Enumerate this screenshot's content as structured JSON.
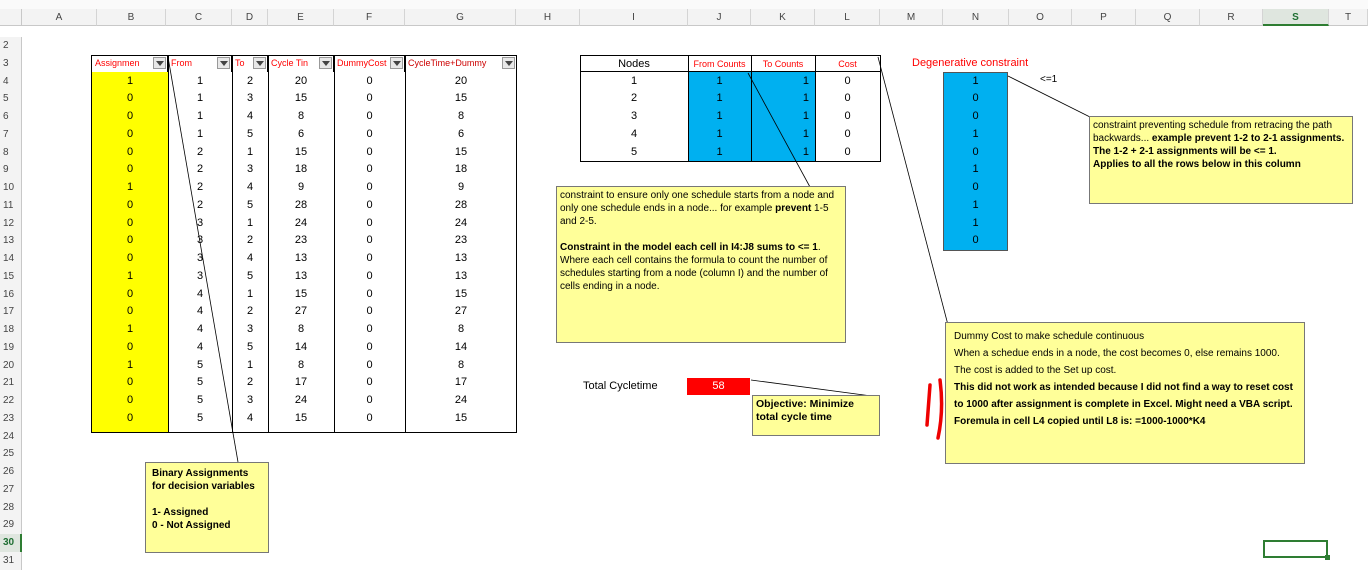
{
  "columns": [
    "A",
    "B",
    "C",
    "D",
    "E",
    "F",
    "G",
    "H",
    "I",
    "J",
    "K",
    "L",
    "M",
    "N",
    "O",
    "P",
    "Q",
    "R",
    "S",
    "T"
  ],
  "rows": [
    "2",
    "3",
    "4",
    "5",
    "6",
    "7",
    "8",
    "9",
    "10",
    "11",
    "12",
    "13",
    "14",
    "15",
    "16",
    "17",
    "18",
    "19",
    "20",
    "21",
    "22",
    "23",
    "24",
    "25",
    "26",
    "27",
    "28",
    "29",
    "30",
    "31"
  ],
  "selected_column": "S",
  "selected_row": "30",
  "assignment_table": {
    "headers": [
      "Assignmen",
      "From",
      "To",
      "Cycle Tin",
      "DummyCost",
      "CycleTime+Dummy"
    ],
    "rows": [
      [
        "1",
        "1",
        "2",
        "20",
        "0",
        "20"
      ],
      [
        "0",
        "1",
        "3",
        "15",
        "0",
        "15"
      ],
      [
        "0",
        "1",
        "4",
        "8",
        "0",
        "8"
      ],
      [
        "0",
        "1",
        "5",
        "6",
        "0",
        "6"
      ],
      [
        "0",
        "2",
        "1",
        "15",
        "0",
        "15"
      ],
      [
        "0",
        "2",
        "3",
        "18",
        "0",
        "18"
      ],
      [
        "1",
        "2",
        "4",
        "9",
        "0",
        "9"
      ],
      [
        "0",
        "2",
        "5",
        "28",
        "0",
        "28"
      ],
      [
        "0",
        "3",
        "1",
        "24",
        "0",
        "24"
      ],
      [
        "0",
        "3",
        "2",
        "23",
        "0",
        "23"
      ],
      [
        "0",
        "3",
        "4",
        "13",
        "0",
        "13"
      ],
      [
        "1",
        "3",
        "5",
        "13",
        "0",
        "13"
      ],
      [
        "0",
        "4",
        "1",
        "15",
        "0",
        "15"
      ],
      [
        "0",
        "4",
        "2",
        "27",
        "0",
        "27"
      ],
      [
        "1",
        "4",
        "3",
        "8",
        "0",
        "8"
      ],
      [
        "0",
        "4",
        "5",
        "14",
        "0",
        "14"
      ],
      [
        "1",
        "5",
        "1",
        "8",
        "0",
        "8"
      ],
      [
        "0",
        "5",
        "2",
        "17",
        "0",
        "17"
      ],
      [
        "0",
        "5",
        "3",
        "24",
        "0",
        "24"
      ],
      [
        "0",
        "5",
        "4",
        "15",
        "0",
        "15"
      ]
    ]
  },
  "nodes_table": {
    "headers": [
      "Nodes",
      "From Counts",
      "To Counts",
      "Cost"
    ],
    "rows": [
      [
        "1",
        "1",
        "1",
        "0"
      ],
      [
        "2",
        "1",
        "1",
        "0"
      ],
      [
        "3",
        "1",
        "1",
        "0"
      ],
      [
        "4",
        "1",
        "1",
        "0"
      ],
      [
        "5",
        "1",
        "1",
        "0"
      ]
    ]
  },
  "degenerative": {
    "header": "Degenerative constraint",
    "limit": "<=1",
    "values": [
      "1",
      "0",
      "0",
      "1",
      "0",
      "1",
      "0",
      "1",
      "1",
      "0"
    ]
  },
  "total": {
    "label": "Total Cycletime",
    "value": "58"
  },
  "notes": {
    "binary": [
      "Binary Assignments",
      "for decision variables",
      "",
      "1- Assigned",
      "0 - Not Assigned"
    ],
    "constraint_node": {
      "p1": "constraint to ensure only one schedule starts from a node and only one schedule ends in a node... for example ",
      "p1_bold": "prevent",
      "p1_end": " 1-5 and 2-5.",
      "p2_bold": "Constraint in the model each cell  in I4:J8 sums to <= 1",
      "p2": ". Where each cell contains the formula to count the number of schedules starting from a node (column I) and the number of cells ending in a node."
    },
    "objective": "Objective: Minimize total cycle time",
    "degenerative_note": {
      "p1": "constraint preventing schedule from retracing the path backwards... ",
      "p1_bold": "example prevent 1-2 to 2-1 assignments. The 1-2 + 2-1 assignments will be <= 1.",
      "p2_bold": "Applies to all the rows below in this column"
    },
    "dummy": {
      "l1": "Dummy Cost to make schedule continuous",
      "l2": "When a schedue ends in a node, the cost becomes 0, else remains 1000. The cost is added to the Set up cost.",
      "l3": "This did not work as intended because I did not find a way to reset cost to 1000 after assignment is complete in Excel. Might need a VBA script.",
      "l4": "Foremula in cell L4 copied until L8 is: =1000-1000*K4"
    }
  },
  "colors": {
    "yellow": "#ffff00",
    "blue": "#00b0f0",
    "red": "#ff0000",
    "note": "#ffff99",
    "header_red": "#ff0000"
  }
}
